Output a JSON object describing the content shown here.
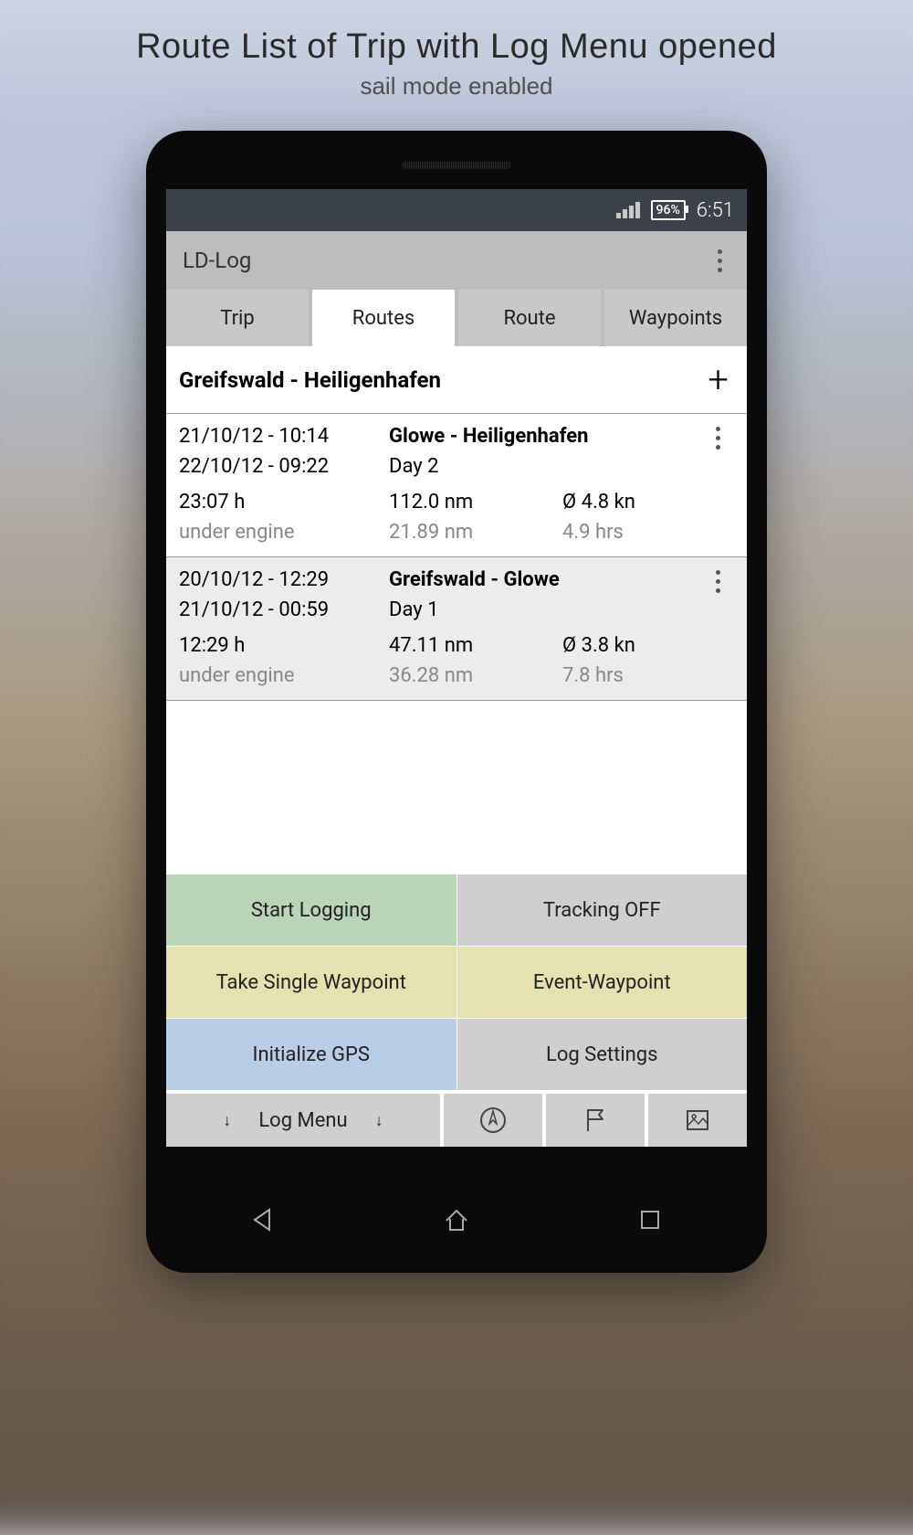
{
  "page_header": {
    "title": "Route List of Trip with Log Menu opened",
    "subtitle": "sail mode enabled"
  },
  "statusbar": {
    "battery": "96%",
    "time": "6:51"
  },
  "appbar": {
    "title": "LD-Log"
  },
  "tabs": {
    "trip": "Trip",
    "routes": "Routes",
    "route": "Route",
    "waypoints": "Waypoints"
  },
  "route_list": {
    "header": "Greifswald - Heiligenhafen",
    "items": [
      {
        "start_dt": "21/10/12 - 10:14",
        "end_dt": "22/10/12 - 09:22",
        "name": "Glowe - Heiligenhafen",
        "day": "Day 2",
        "duration": "23:07 h",
        "distance": "112.0 nm",
        "avg_speed": "Ø 4.8 kn",
        "engine_label": "under engine",
        "engine_dist": "21.89 nm",
        "engine_hrs": "4.9 hrs"
      },
      {
        "start_dt": "20/10/12 - 12:29",
        "end_dt": "21/10/12 - 00:59",
        "name": "Greifswald - Glowe",
        "day": "Day 1",
        "duration": "12:29 h",
        "distance": "47.11 nm",
        "avg_speed": "Ø 3.8 kn",
        "engine_label": "under engine",
        "engine_dist": "36.28 nm",
        "engine_hrs": "7.8 hrs"
      }
    ]
  },
  "log_menu": {
    "start_logging": "Start Logging",
    "tracking_off": "Tracking OFF",
    "single_wp": "Take Single Waypoint",
    "event_wp": "Event-Waypoint",
    "init_gps": "Initialize GPS",
    "log_settings": "Log Settings"
  },
  "bottom_bar": {
    "log_menu": "Log Menu"
  }
}
